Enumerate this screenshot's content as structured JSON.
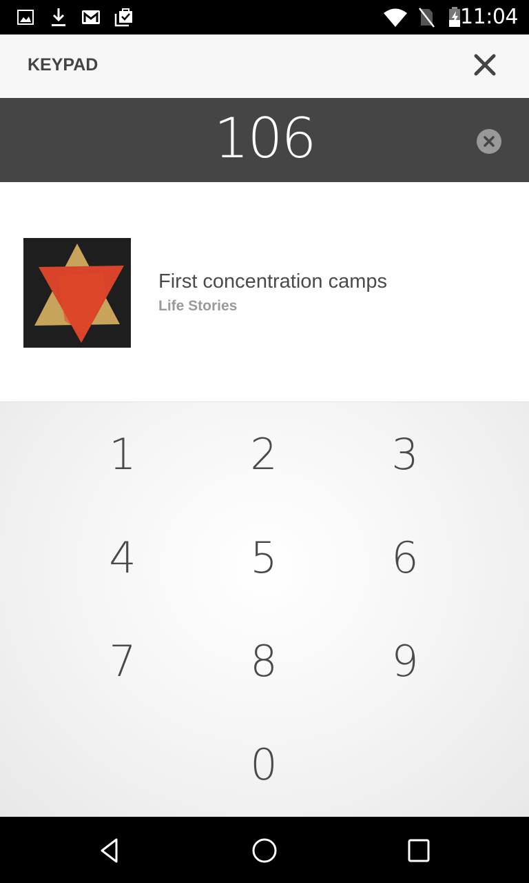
{
  "status_bar": {
    "left_icons": [
      "image-icon",
      "download-icon",
      "gmail-icon",
      "clipboard-check-icon"
    ],
    "right_icons": [
      "wifi-icon",
      "no-sim-icon",
      "battery-charging-icon"
    ],
    "time": "11:04"
  },
  "header": {
    "title": "KEYPAD",
    "close_icon": "close-icon"
  },
  "entry": {
    "value": "106",
    "clear_icon": "clear-circle-icon"
  },
  "results": [
    {
      "title": "First concentration camps",
      "subtitle": "Life Stories",
      "thumbnail": "star-badge-image"
    }
  ],
  "keypad": {
    "keys": [
      "1",
      "2",
      "3",
      "4",
      "5",
      "6",
      "7",
      "8",
      "9",
      "0"
    ]
  },
  "nav_bar": {
    "buttons": [
      "back-icon",
      "home-icon",
      "recents-icon"
    ]
  },
  "colors": {
    "entry_bar_bg": "#454545",
    "header_bg": "#f7f7f7",
    "text_dark": "#4a4a4a",
    "text_muted": "#9a9a9a"
  }
}
